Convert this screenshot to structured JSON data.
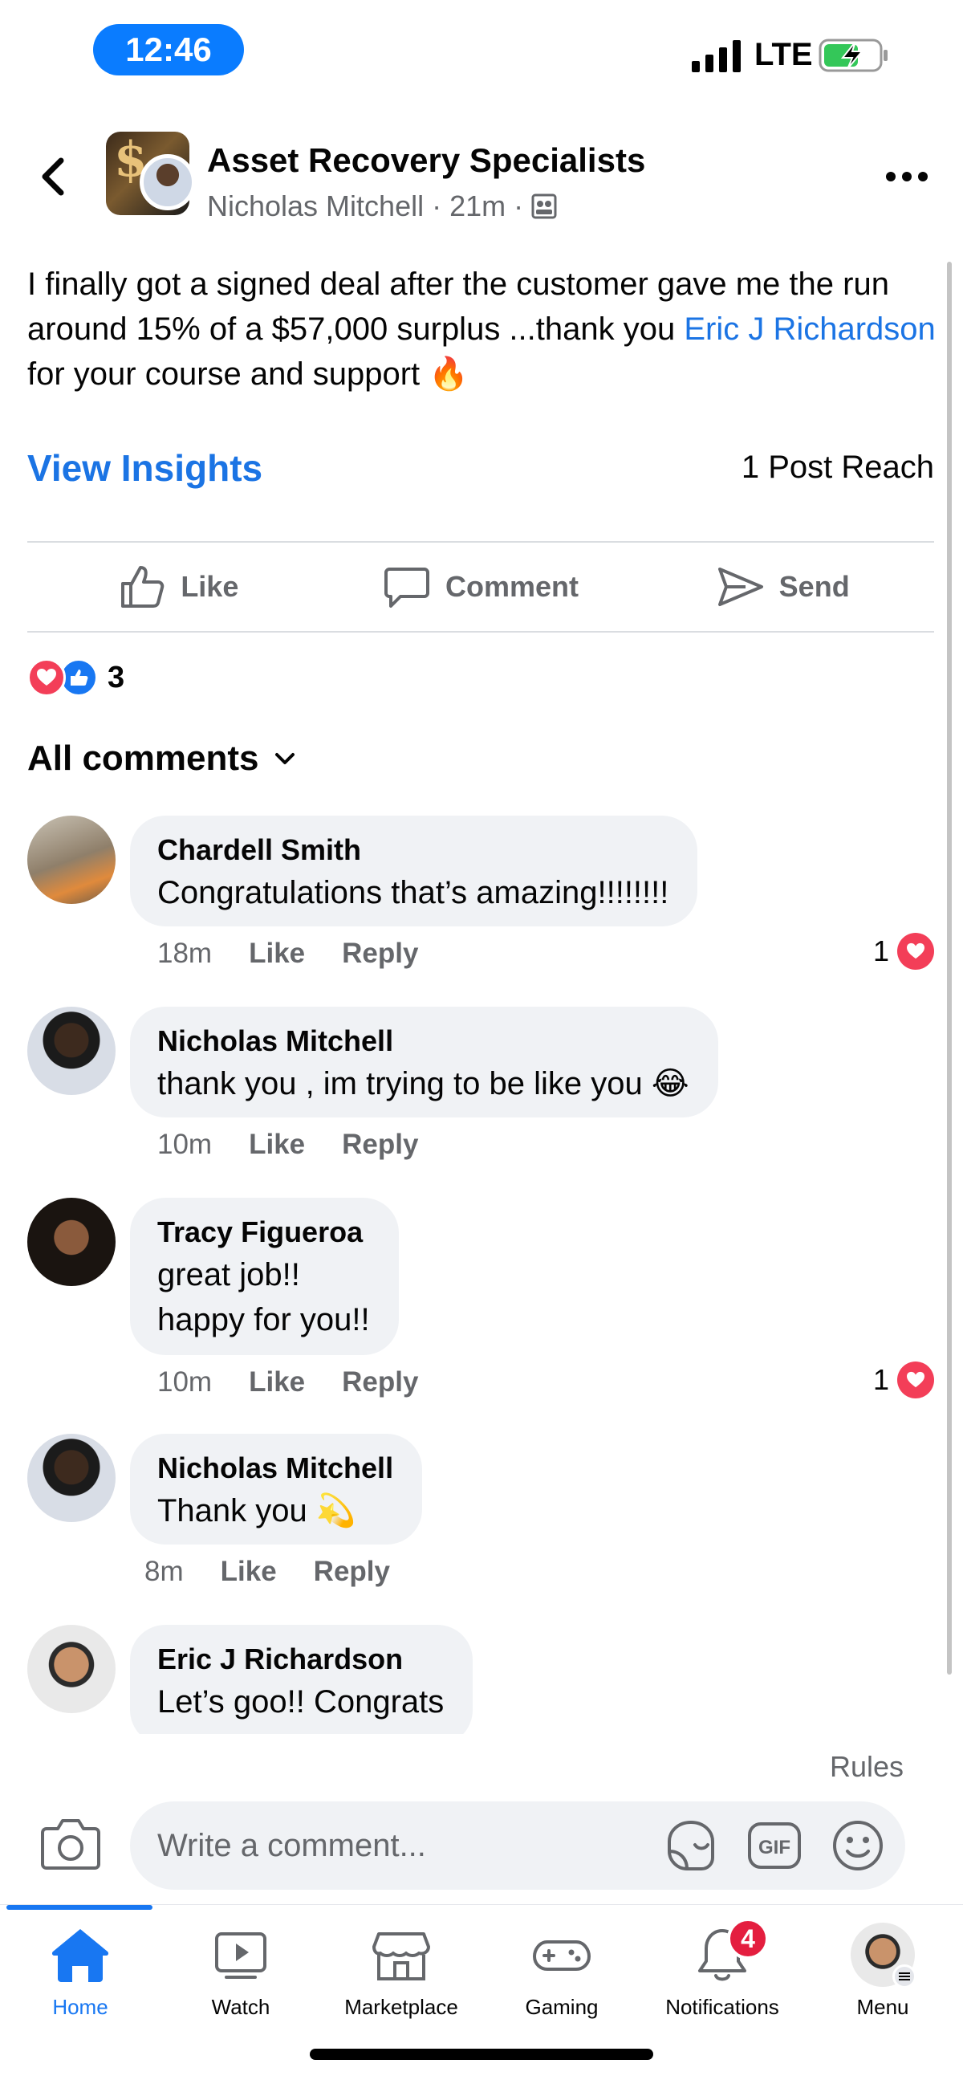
{
  "status_bar": {
    "time": "12:46",
    "network": "LTE",
    "colors": {
      "time_pill": "#0a7cff",
      "battery_charge": "#34c759"
    }
  },
  "header": {
    "group_name": "Asset Recovery Specialists",
    "author": "Nicholas Mitchell",
    "time_ago": "21m",
    "separator": "·",
    "icons": [
      "back-chevron-icon",
      "group-members-icon",
      "more-dots-icon"
    ]
  },
  "post": {
    "text_before": "I finally got a signed deal after the customer gave me the run around 15% of a $57,000 surplus ...thank you ",
    "mention": "Eric J Richardson",
    "text_after": " for your course and support ",
    "emoji": "🔥",
    "view_insights": "View Insights",
    "reach": "1 Post Reach"
  },
  "actions": {
    "like": "Like",
    "comment": "Comment",
    "send": "Send"
  },
  "reactions": {
    "count": "3",
    "icons": [
      "heart-reaction-icon",
      "like-reaction-icon"
    ]
  },
  "comments_header": {
    "label": "All comments"
  },
  "comments": [
    {
      "name": "Chardell Smith",
      "text": "Congratulations that’s amazing!!!!!!!!",
      "time": "18m",
      "like": "Like",
      "reply": "Reply",
      "likes": "1"
    },
    {
      "name": "Nicholas Mitchell",
      "text": "thank you , im trying to be like you 😂",
      "time": "10m",
      "like": "Like",
      "reply": "Reply",
      "likes": ""
    },
    {
      "name": "Tracy Figueroa",
      "text": "great job!!",
      "text2": "happy for you!!",
      "time": "10m",
      "like": "Like",
      "reply": "Reply",
      "likes": "1"
    },
    {
      "name": "Nicholas Mitchell",
      "text": "Thank you 💫",
      "time": "8m",
      "like": "Like",
      "reply": "Reply",
      "likes": ""
    },
    {
      "name": "Eric J Richardson",
      "text": "Let’s goo!! Congrats"
    }
  ],
  "rules": "Rules",
  "composer": {
    "placeholder": "Write a comment...",
    "icons": [
      "camera-icon",
      "sticker-icon",
      "gif-icon",
      "emoji-icon"
    ],
    "gif": "GIF"
  },
  "tabs": [
    {
      "label": "Home",
      "icon": "home-icon",
      "active": true
    },
    {
      "label": "Watch",
      "icon": "watch-icon"
    },
    {
      "label": "Marketplace",
      "icon": "marketplace-icon"
    },
    {
      "label": "Gaming",
      "icon": "gaming-icon"
    },
    {
      "label": "Notifications",
      "icon": "bell-icon",
      "badge": "4"
    },
    {
      "label": "Menu",
      "icon": "profile-menu-icon"
    }
  ],
  "colors": {
    "accent": "#1877f2",
    "link": "#1b74e4",
    "heart": "#f33e58",
    "badge": "#e41e3f",
    "bubble": "#f0f2f5",
    "secondary_text": "#65676b"
  }
}
